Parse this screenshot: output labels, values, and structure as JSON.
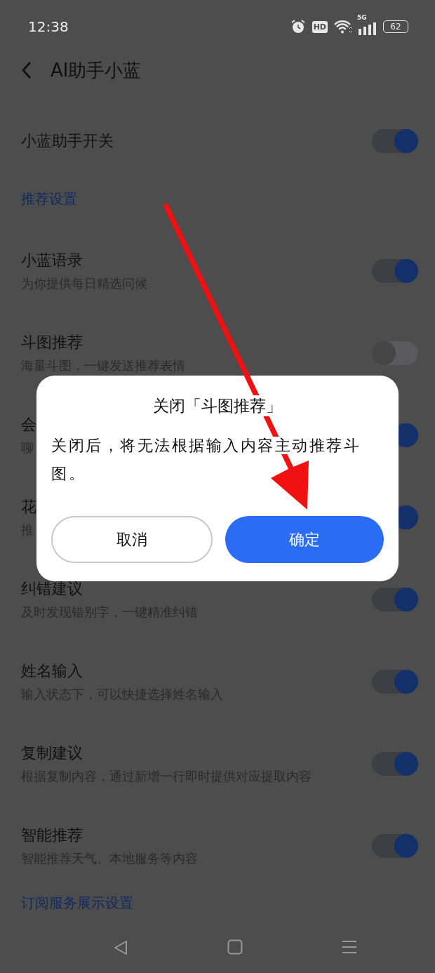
{
  "status_bar": {
    "time": "12:38",
    "hd": "HD",
    "network": "5G",
    "battery": "62"
  },
  "header": {
    "title": "AI助手小蓝"
  },
  "master": {
    "title": "小蓝助手开关",
    "on": true
  },
  "sections": [
    {
      "heading": "推荐设置",
      "items": [
        {
          "title": "小蓝语录",
          "subtitle": "为你提供每日精选问候",
          "on": true
        },
        {
          "title": "斗图推荐",
          "subtitle": "海量斗图，一键发送推荐表情",
          "on": false
        },
        {
          "title": "会",
          "subtitle": "聊",
          "on": true
        },
        {
          "title": "花",
          "subtitle": "推",
          "on": true
        },
        {
          "title": "纠错建议",
          "subtitle": "及时发现错别字，一键精准纠错",
          "on": true
        },
        {
          "title": "姓名输入",
          "subtitle": "输入状态下，可以快捷选择姓名输入",
          "on": true
        },
        {
          "title": "复制建议",
          "subtitle": "根据复制内容，通过新增一行即时提供对应提取内容",
          "on": true
        },
        {
          "title": "智能推荐",
          "subtitle": "智能推荐天气、本地服务等内容",
          "on": true
        }
      ]
    },
    {
      "heading": "订阅服务展示设置"
    }
  ],
  "dialog": {
    "title": "关闭「斗图推荐」",
    "message": "关闭后，将无法根据输入内容主动推荐斗图。",
    "cancel": "取消",
    "confirm": "确定"
  }
}
